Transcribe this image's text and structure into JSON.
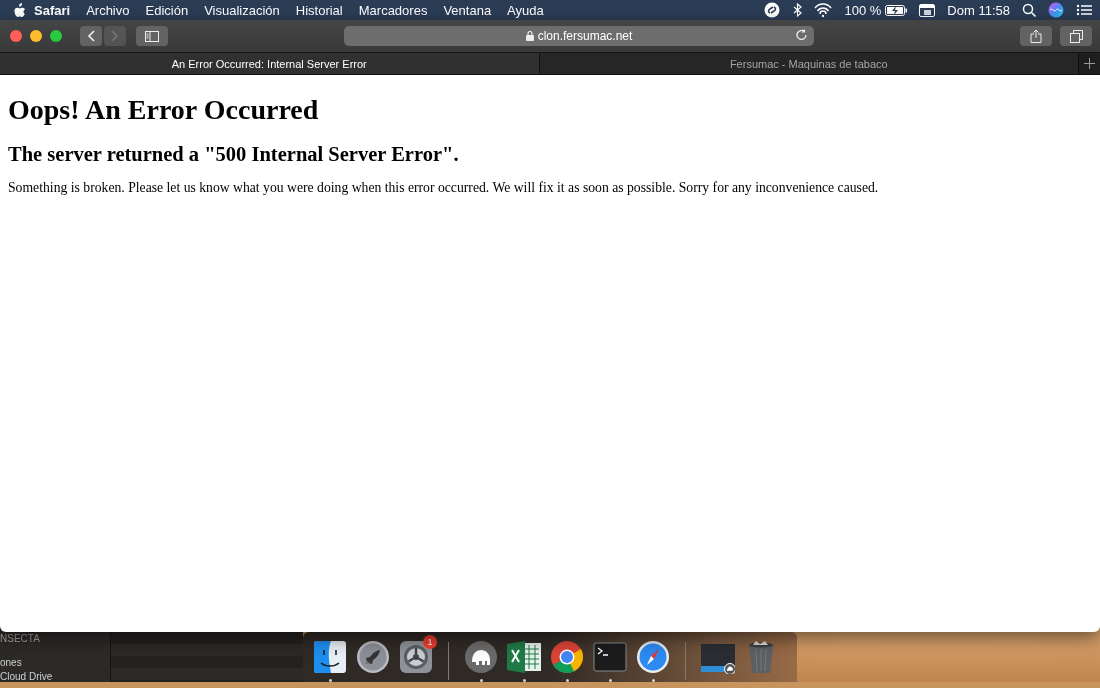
{
  "menu_bar": {
    "items": [
      {
        "label": "Safari",
        "kind": "app"
      },
      {
        "label": "Archivo",
        "kind": "menu"
      },
      {
        "label": "Edición",
        "kind": "menu"
      },
      {
        "label": "Visualización",
        "kind": "menu"
      },
      {
        "label": "Historial",
        "kind": "menu"
      },
      {
        "label": "Marcadores",
        "kind": "menu"
      },
      {
        "label": "Ventana",
        "kind": "menu"
      },
      {
        "label": "Ayuda",
        "kind": "menu"
      }
    ],
    "battery": "100 %",
    "clock": "Dom 11:58"
  },
  "toolbar": {
    "back": {
      "disabled": false
    },
    "forward": {
      "disabled": true
    },
    "url": "clon.fersumac.net"
  },
  "tabs": [
    {
      "label": "An Error Occurred: Internal Server Error",
      "selected": true
    },
    {
      "label": "Fersumac - Maquinas de tabaco",
      "selected": false
    }
  ],
  "page": {
    "heading": "Oops! An Error Occurred",
    "subheading": "The server returned a \"500 Internal Server Error\".",
    "message": "Something is broken. Please let us know what you were doing when this error occurred. We will fix it as soon as possible. Sorry for any inconvenience caused."
  },
  "background_window": {
    "items": [
      "NSECTA",
      "ones",
      "Cloud Drive"
    ]
  },
  "dock": {
    "items": [
      {
        "kind": "finder",
        "running": true
      },
      {
        "kind": "rocket",
        "running": false
      },
      {
        "kind": "gear",
        "running": false,
        "badge": "1"
      },
      {
        "kind": "separator"
      },
      {
        "kind": "elephant",
        "running": true
      },
      {
        "kind": "spreadsheet",
        "running": true
      },
      {
        "kind": "wheel",
        "running": true
      },
      {
        "kind": "terminal",
        "running": true
      },
      {
        "kind": "compass",
        "running": true
      },
      {
        "kind": "separator"
      },
      {
        "kind": "thumbnail",
        "running": false
      },
      {
        "kind": "trash",
        "running": false
      }
    ]
  }
}
